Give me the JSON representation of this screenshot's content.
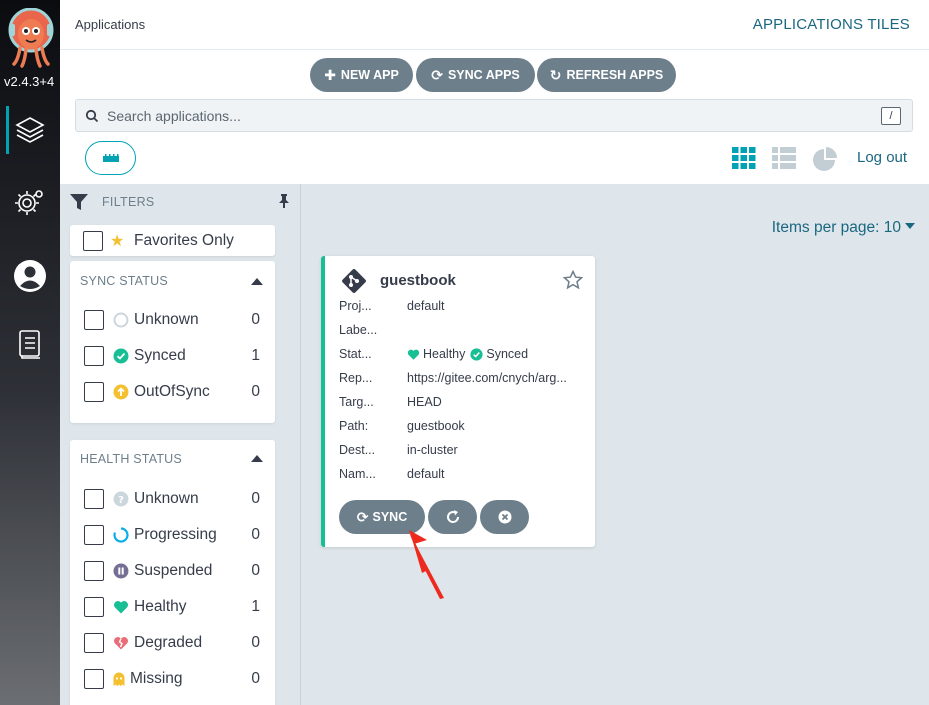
{
  "app": {
    "version": "v2.4.3+4",
    "page_title": "Applications",
    "view_title": "APPLICATIONS TILES"
  },
  "nav": {
    "items": [
      {
        "name": "applications",
        "icon": "layers-icon",
        "active": true
      },
      {
        "name": "settings",
        "icon": "gear-icon",
        "active": false
      },
      {
        "name": "user-info",
        "icon": "user-icon",
        "active": false
      },
      {
        "name": "documentation",
        "icon": "docs-icon",
        "active": false
      }
    ]
  },
  "toolbar": {
    "new_app": "NEW APP",
    "sync_apps": "SYNC APPS",
    "refresh_apps": "REFRESH APPS",
    "search_placeholder": "Search applications...",
    "search_shortcut": "/",
    "logout": "Log out"
  },
  "filters": {
    "header": "FILTERS",
    "favorites": "Favorites Only",
    "sync_status": {
      "title": "SYNC STATUS",
      "items": [
        {
          "label": "Unknown",
          "count": "0",
          "icon": "circle-outline-icon",
          "color": "#ccd6dd"
        },
        {
          "label": "Synced",
          "count": "1",
          "icon": "check-circle-icon",
          "color": "#18be94"
        },
        {
          "label": "OutOfSync",
          "count": "0",
          "icon": "arrow-up-circle-icon",
          "color": "#f4c030"
        }
      ]
    },
    "health_status": {
      "title": "HEALTH STATUS",
      "items": [
        {
          "label": "Unknown",
          "count": "0",
          "icon": "question-circle-icon",
          "color": "#ccd6dd"
        },
        {
          "label": "Progressing",
          "count": "0",
          "icon": "progress-ring-icon",
          "color": "#0dadea"
        },
        {
          "label": "Suspended",
          "count": "0",
          "icon": "pause-circle-icon",
          "color": "#766f94"
        },
        {
          "label": "Healthy",
          "count": "1",
          "icon": "heart-icon",
          "color": "#18be94"
        },
        {
          "label": "Degraded",
          "count": "0",
          "icon": "broken-heart-icon",
          "color": "#e96d76"
        },
        {
          "label": "Missing",
          "count": "0",
          "icon": "ghost-icon",
          "color": "#f4c030"
        }
      ]
    }
  },
  "main": {
    "items_per_page": "Items per page: 10"
  },
  "card": {
    "name": "guestbook",
    "rows": [
      {
        "key": "Proj...",
        "value": "default"
      },
      {
        "key": "Labe...",
        "value": ""
      },
      {
        "key": "Stat...",
        "value": ""
      },
      {
        "key": "Rep...",
        "value": "https://gitee.com/cnych/arg..."
      },
      {
        "key": "Targ...",
        "value": "HEAD"
      },
      {
        "key": "Path:",
        "value": "guestbook"
      },
      {
        "key": "Dest...",
        "value": "in-cluster"
      },
      {
        "key": "Nam...",
        "value": "default"
      }
    ],
    "health": "Healthy",
    "sync": "Synced",
    "sync_button": "SYNC"
  },
  "colors": {
    "accent": "#00a2b3",
    "link": "#1b6780",
    "button": "#6d7f8b",
    "healthy": "#18be94"
  }
}
